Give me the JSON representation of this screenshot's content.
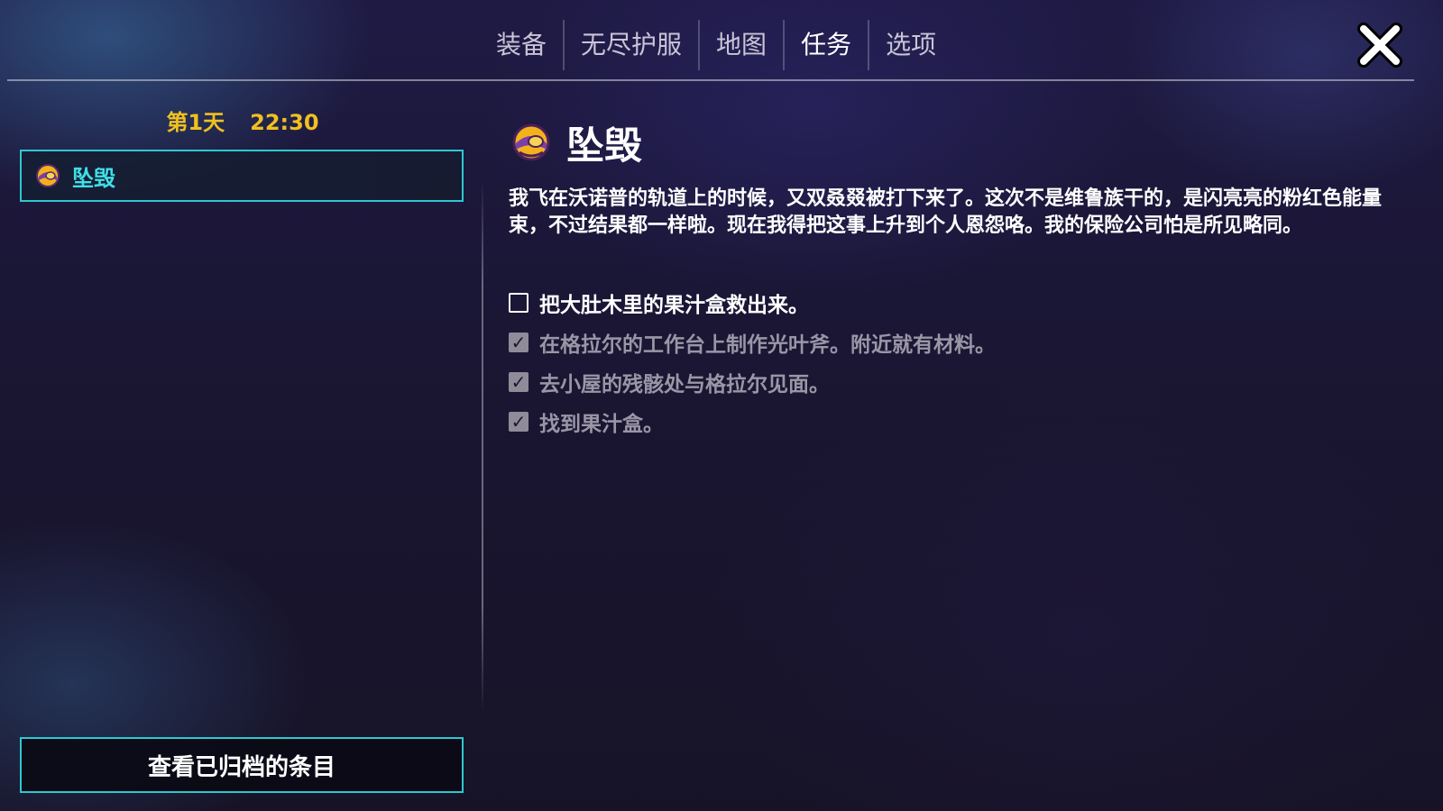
{
  "nav": {
    "tabs": [
      {
        "label": "装备",
        "active": false
      },
      {
        "label": "无尽护服",
        "active": false
      },
      {
        "label": "地图",
        "active": false
      },
      {
        "label": "任务",
        "active": true
      },
      {
        "label": "选项",
        "active": false
      }
    ],
    "close_icon": "close-x-icon"
  },
  "sidebar": {
    "day": "第1天",
    "time": "22:30",
    "quests": [
      {
        "label": "坠毁",
        "icon": "helmet-icon",
        "selected": true
      }
    ],
    "archive_button": "查看已归档的条目"
  },
  "detail": {
    "title": "坠毁",
    "icon": "helmet-icon",
    "description": "我飞在沃诺普的轨道上的时候，又双叒叕被打下来了。这次不是维鲁族干的，是闪亮亮的粉红色能量束，不过结果都一样啦。现在我得把这事上升到个人恩怨咯。我的保险公司怕是所见略同。",
    "objectives": [
      {
        "text": "把大肚木里的果汁盒救出来。",
        "done": false
      },
      {
        "text": "在格拉尔的工作台上制作光叶斧。附近就有材料。",
        "done": true
      },
      {
        "text": "去小屋的残骸处与格拉尔见面。",
        "done": true
      },
      {
        "text": "找到果汁盒。",
        "done": true
      }
    ]
  },
  "colors": {
    "accent_cyan": "#2ec8d0",
    "time_gold": "#f0c020",
    "done_gray": "#9a96a6"
  }
}
